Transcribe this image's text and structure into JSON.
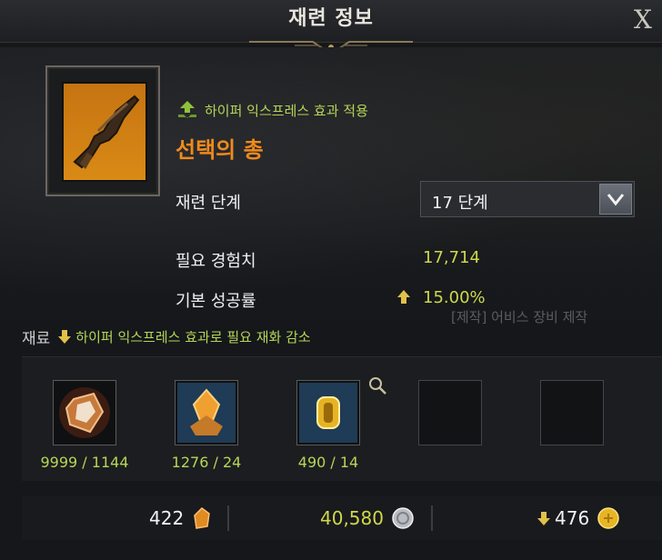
{
  "window": {
    "title": "재련 정보",
    "close_label": "X"
  },
  "item": {
    "buff_text": "하이퍼 익스프레스 효과 적용",
    "name": "선택의 총",
    "colors": {
      "name": "#f08a1c",
      "buff": "#b6d657",
      "icon_bg": "#d98a15"
    }
  },
  "refine": {
    "stage_label": "재련 단계",
    "stage_value": "17 단계",
    "exp_label": "필요 경험치",
    "exp_value": "17,714",
    "rate_label": "기본 성공률",
    "rate_value": "15.00%"
  },
  "background_text": "[제작] 어비스 장비 제작",
  "materials": {
    "title": "재료",
    "note": "하이퍼 익스프레스 효과로 필요 재화 감소",
    "slots": [
      {
        "icon": "crystal-stone-icon",
        "count": "9999 / 1144"
      },
      {
        "icon": "amber-crystal-icon",
        "count": "1276 / 24"
      },
      {
        "icon": "gold-gem-icon",
        "count": "490 / 14"
      },
      {
        "icon": "empty-slot",
        "count": ""
      },
      {
        "icon": "empty-slot",
        "count": ""
      }
    ]
  },
  "costs": [
    {
      "value": "422",
      "icon": "shard-icon"
    },
    {
      "value": "40,580",
      "icon": "silver-coin-icon"
    },
    {
      "value": "476",
      "icon": "gold-coin-icon"
    }
  ]
}
